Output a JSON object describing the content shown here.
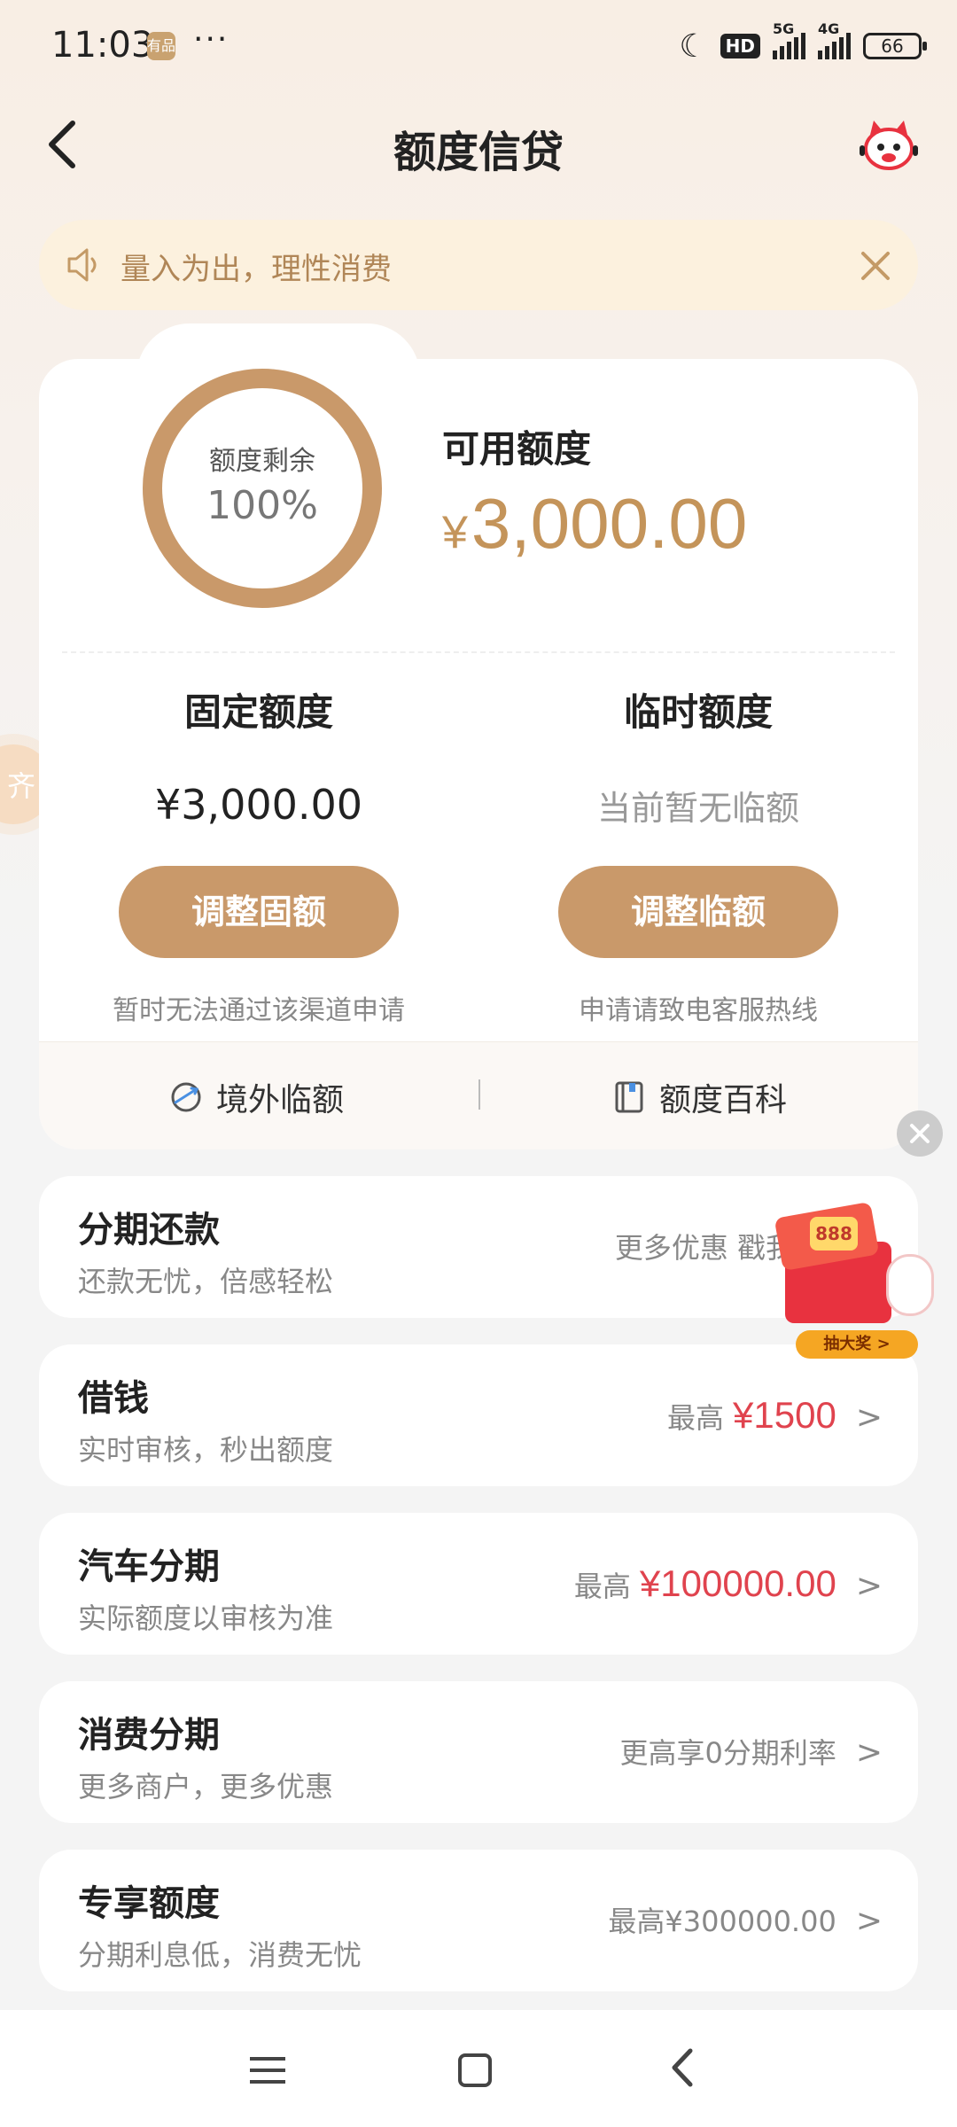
{
  "status_bar": {
    "time": "11:03",
    "app_badge": "有品",
    "more": "···",
    "network_1": "5G",
    "network_2": "4G",
    "battery": "66"
  },
  "header": {
    "title": "额度信贷",
    "back_icon": "chevron-left-icon",
    "mascot_icon": "cat-mascot-icon"
  },
  "notice": {
    "text": "量入为出，理性消费",
    "icon": "speaker-icon",
    "close": "×"
  },
  "quota": {
    "ring_label": "额度剩余",
    "ring_percent": "100%",
    "ring_fraction": 1.0,
    "available_label": "可用额度",
    "available_currency": "¥",
    "available_amount": "3,000.00",
    "fixed": {
      "title": "固定额度",
      "amount": "¥3,000.00",
      "button": "调整固额",
      "note": "暂时无法通过该渠道申请"
    },
    "temporary": {
      "title": "临时额度",
      "status": "当前暂无临额",
      "button": "调整临额",
      "note": "申请请致电客服热线"
    },
    "footer": {
      "overseas": "境外临额",
      "wiki": "额度百科"
    }
  },
  "side_float": {
    "text": "齐"
  },
  "promo": {
    "coin_text": "888",
    "cta": "抽大奖 >"
  },
  "list": [
    {
      "title": "分期还款",
      "subtitle": "还款无忧，倍感轻松",
      "right_plain": "更多优惠 戳我",
      "chev": ""
    },
    {
      "title": "借钱",
      "subtitle": "实时审核，秒出额度",
      "right_prefix": "最高",
      "right_amount": "¥1500",
      "chev": ">"
    },
    {
      "title": "汽车分期",
      "subtitle": "实际额度以审核为准",
      "right_prefix": "最高",
      "right_amount": "¥100000.00",
      "chev": ">"
    },
    {
      "title": "消费分期",
      "subtitle": "更多商户，更多优惠",
      "right_plain": "更高享0分期利率",
      "chev": ">"
    },
    {
      "title": "专享额度",
      "subtitle": "分期利息低，消费无忧",
      "right_plain": "最高¥300000.00",
      "chev": ">"
    }
  ],
  "colors": {
    "accent_gold": "#c9996a",
    "amount_red": "#e0434e",
    "notice_bg": "#fcf1de"
  }
}
